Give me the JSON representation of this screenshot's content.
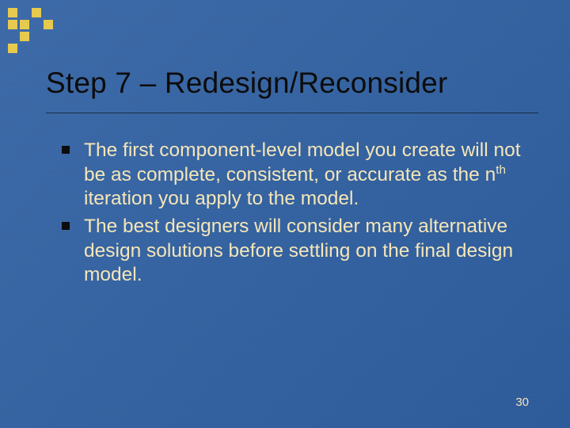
{
  "title": "Step 7 – Redesign/Reconsider",
  "bullets": [
    {
      "pre": "The first component-level model you create will not be as complete, consistent, or accurate as the n",
      "sup": "th",
      "post": " iteration you apply to the model."
    },
    {
      "pre": "The best designers will consider many alternative design solutions before settling on the final design model.",
      "sup": "",
      "post": ""
    }
  ],
  "pageNumber": "30"
}
